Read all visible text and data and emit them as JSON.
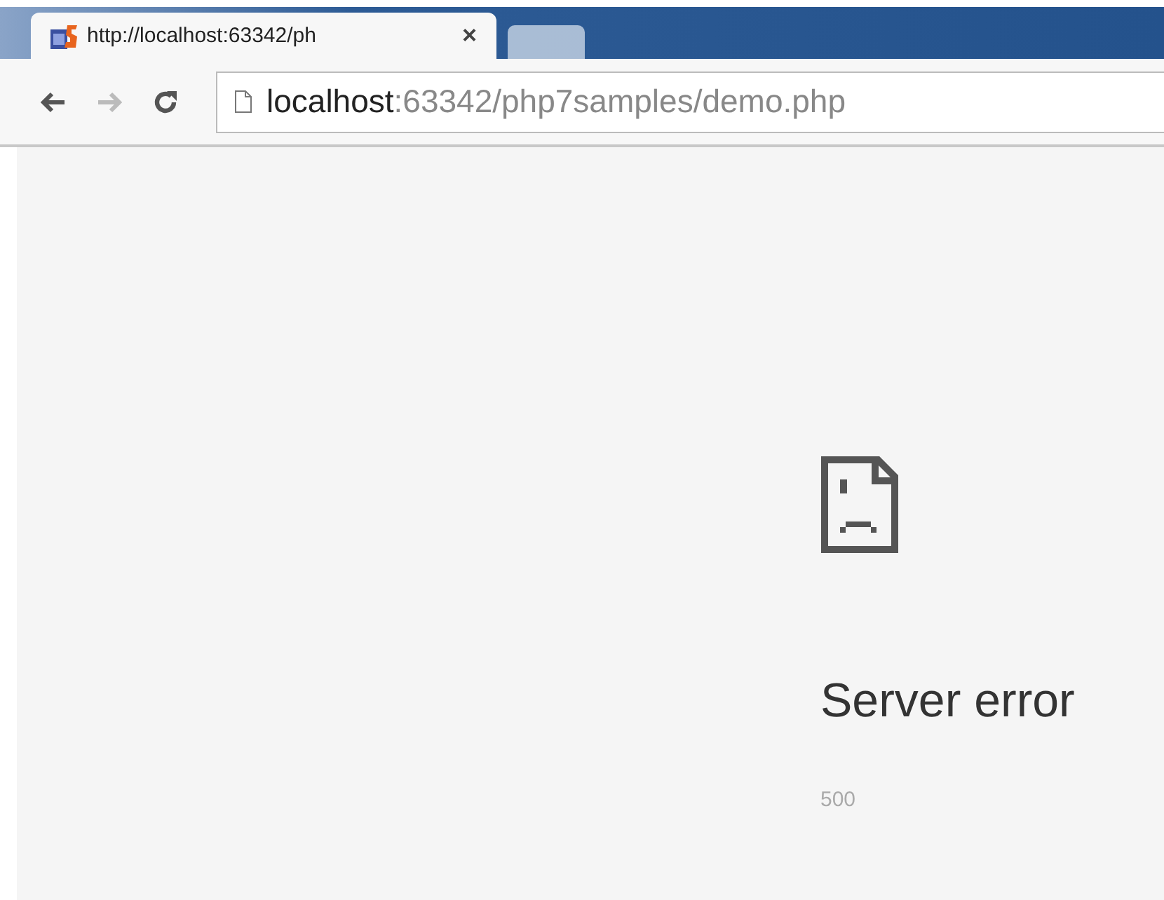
{
  "tabs": [
    {
      "title": "http://localhost:63342/ph",
      "close": "×",
      "selected": true
    },
    {
      "selected": false
    }
  ],
  "toolbar": {
    "back_disabled": false,
    "forward_disabled": true,
    "address": {
      "host": "localhost",
      "rest": ":63342/php7samples/demo.php"
    }
  },
  "error": {
    "title": "Server error",
    "code": "500"
  }
}
